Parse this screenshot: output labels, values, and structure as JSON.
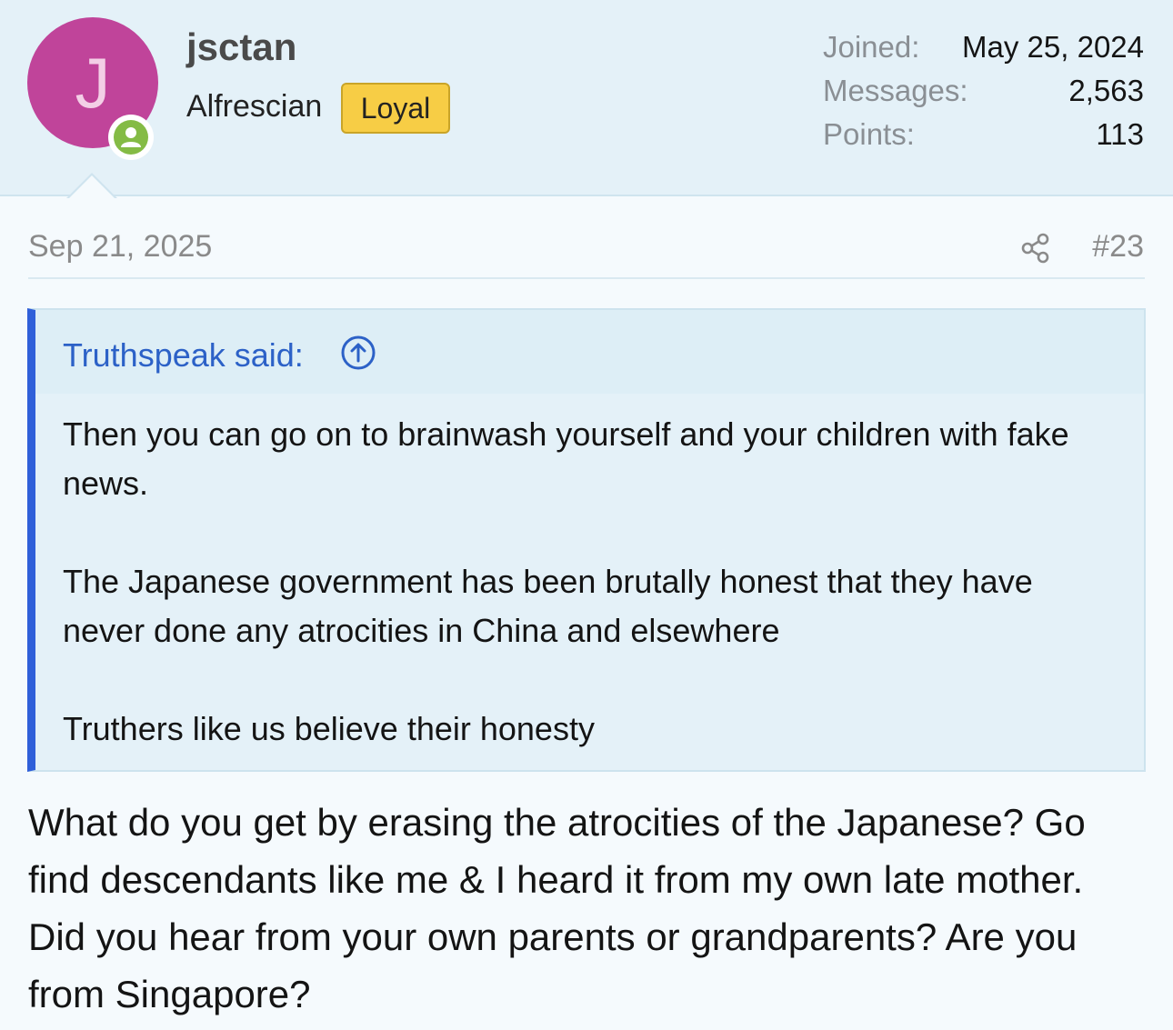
{
  "user": {
    "avatar_letter": "J",
    "avatar_color": "#c0449a",
    "online_icon": "person-icon",
    "username": "jsctan",
    "title": "Alfrescian",
    "badge": "Loyal",
    "badge_color": "#f7cd45",
    "stats": {
      "joined_label": "Joined:",
      "joined_value": "May 25, 2024",
      "messages_label": "Messages:",
      "messages_value": "2,563",
      "points_label": "Points:",
      "points_value": "113"
    }
  },
  "post": {
    "date": "Sep 21, 2025",
    "share_icon": "share-icon",
    "number": "#23",
    "quote": {
      "author_line": "Truthspeak said:",
      "jump_icon": "arrow-up-circle-icon",
      "accent_color": "#2f5fd9",
      "paragraphs": [
        "Then you can go on to brainwash yourself and your children with fake news.",
        "The Japanese government has been brutally honest that they have never done any atrocities in China and elsewhere",
        "Truthers like us believe their honesty"
      ]
    },
    "body": "What do you get by erasing the atrocities of the Japanese? Go find descendants like me & I heard it from my own late mother. Did you hear from your own parents or grandparents? Are you from Singapore?"
  }
}
